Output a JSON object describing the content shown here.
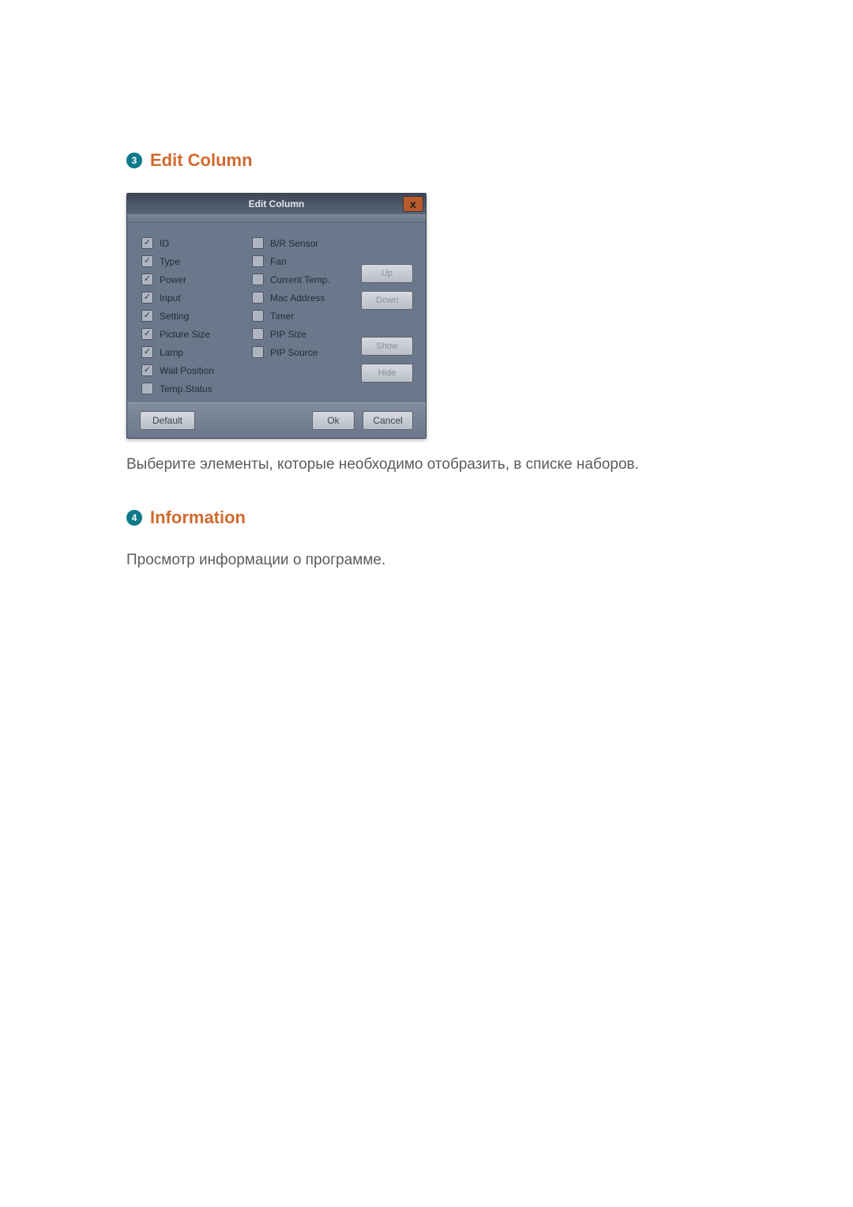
{
  "section3": {
    "number": "3",
    "title": "Edit Column",
    "caption": "Выберите элементы, которые необходимо отобразить, в списке наборов."
  },
  "section4": {
    "number": "4",
    "title": "Information",
    "caption": "Просмотр информации о программе."
  },
  "dialog": {
    "title": "Edit Column",
    "close_symbol": "x",
    "left_column": [
      {
        "label": "ID",
        "checked": true
      },
      {
        "label": "Type",
        "checked": true
      },
      {
        "label": "Power",
        "checked": true
      },
      {
        "label": "Input",
        "checked": true
      },
      {
        "label": "Setting",
        "checked": true
      },
      {
        "label": "Picture Size",
        "checked": true
      },
      {
        "label": "Lamp",
        "checked": true
      },
      {
        "label": "Wall Position",
        "checked": true
      },
      {
        "label": "Temp.Status",
        "checked": false
      }
    ],
    "mid_column": [
      {
        "label": "B/R Sensor",
        "checked": false
      },
      {
        "label": "Fan",
        "checked": false
      },
      {
        "label": "Current Temp.",
        "checked": false
      },
      {
        "label": "Mac Address",
        "checked": false
      },
      {
        "label": "Timer",
        "checked": false
      },
      {
        "label": "PIP Size",
        "checked": false
      },
      {
        "label": "PIP Source",
        "checked": false
      }
    ],
    "side_buttons": {
      "up": "Up",
      "down": "Down",
      "show": "Show",
      "hide": "Hide"
    },
    "footer": {
      "default": "Default",
      "ok": "Ok",
      "cancel": "Cancel"
    }
  }
}
